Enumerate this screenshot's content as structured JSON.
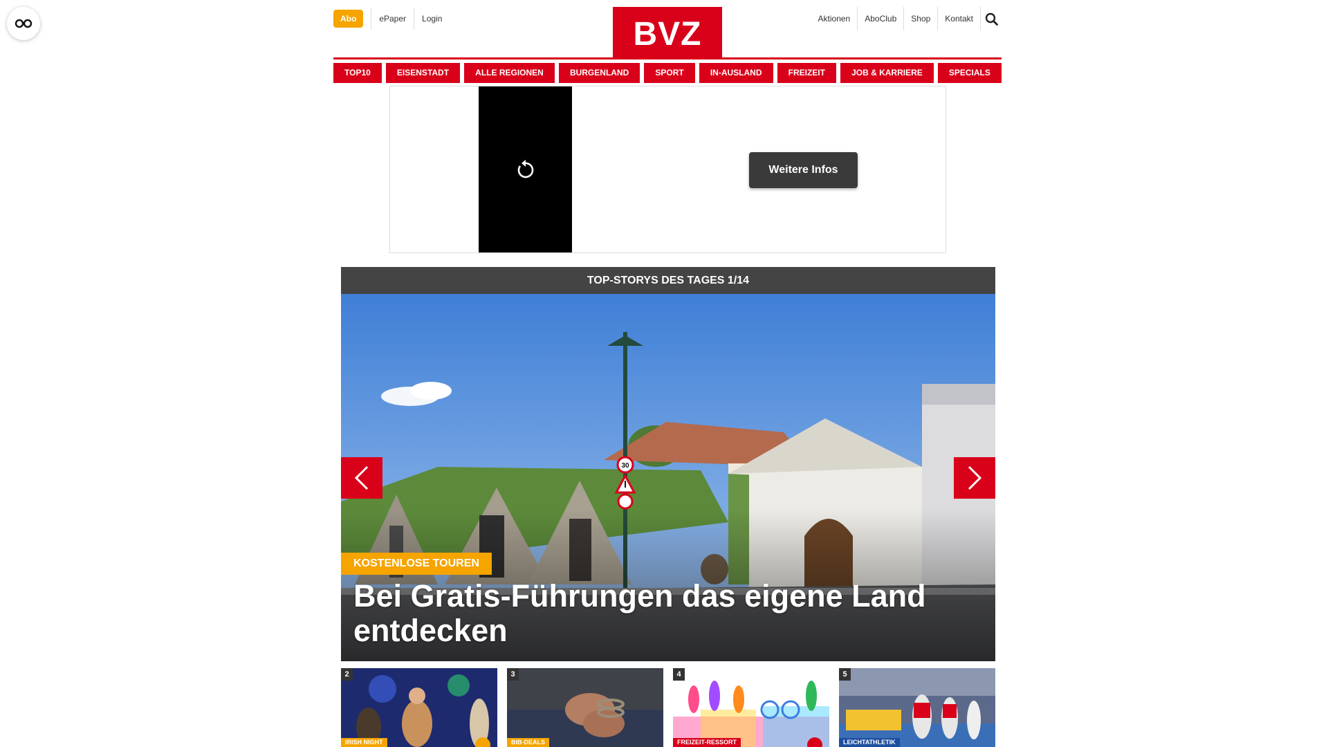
{
  "accessibility": {
    "icon": "glasses-icon"
  },
  "header": {
    "abo_label": "Abo",
    "top_left_links": [
      "ePaper",
      "Login"
    ],
    "logo_text": "BVZ",
    "top_right_links": [
      "Aktionen",
      "AboClub",
      "Shop",
      "Kontakt"
    ],
    "search_icon": "search-icon"
  },
  "nav": {
    "items": [
      "TOP10",
      "EISENSTADT",
      "ALLE REGIONEN",
      "BURGENLAND",
      "SPORT",
      "IN-AUSLAND",
      "FREIZEIT",
      "JOB & KARRIERE",
      "SPECIALS"
    ]
  },
  "ad": {
    "button_label": "Weitere Infos",
    "replay_icon": "replay-icon"
  },
  "stories": {
    "header": "TOP-STORYS DES TAGES 1/14",
    "hero": {
      "kicker": "KOSTENLOSE TOUREN",
      "headline": "Bei Gratis-Führungen das eigene Land entdecken",
      "sign_speed": "30"
    },
    "thumbs": [
      {
        "num": "2",
        "tag": "IRISH NIGHT",
        "tag_color": "#f5a400",
        "badge_color": "#f5a400"
      },
      {
        "num": "3",
        "tag": "BIB-DEALS",
        "tag_color": "#f5a400"
      },
      {
        "num": "4",
        "tag": "FREIZEIT-RESSORT",
        "tag_color": "#d9001a",
        "badge_color": "#d9001a"
      },
      {
        "num": "5",
        "tag": "LEICHTATHLETIK",
        "tag_color": "#1d4fa0"
      }
    ]
  },
  "colors": {
    "brand_red": "#d9001a",
    "accent_orange": "#f5a400",
    "dark": "#444444"
  }
}
